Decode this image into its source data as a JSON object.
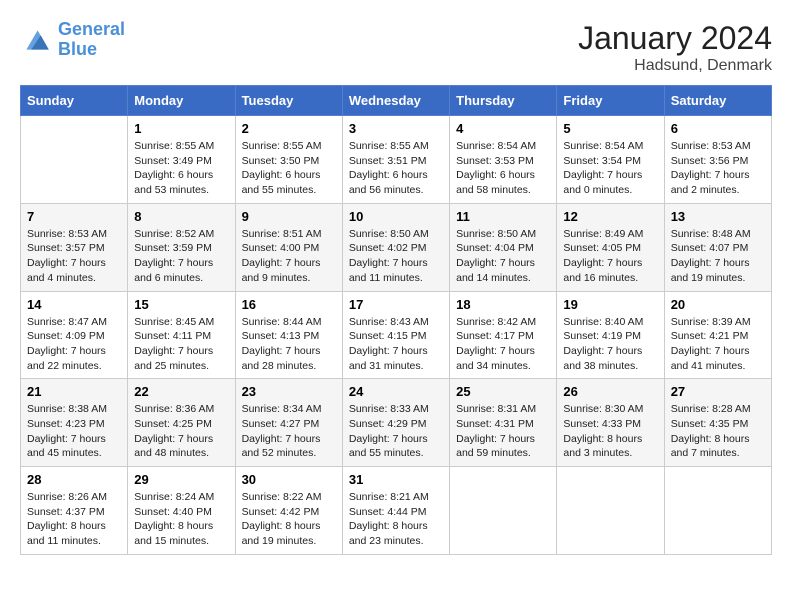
{
  "logo": {
    "line1": "General",
    "line2": "Blue"
  },
  "title": "January 2024",
  "location": "Hadsund, Denmark",
  "days_header": [
    "Sunday",
    "Monday",
    "Tuesday",
    "Wednesday",
    "Thursday",
    "Friday",
    "Saturday"
  ],
  "weeks": [
    [
      {
        "day": "",
        "sunrise": "",
        "sunset": "",
        "daylight": ""
      },
      {
        "day": "1",
        "sunrise": "Sunrise: 8:55 AM",
        "sunset": "Sunset: 3:49 PM",
        "daylight": "Daylight: 6 hours and 53 minutes."
      },
      {
        "day": "2",
        "sunrise": "Sunrise: 8:55 AM",
        "sunset": "Sunset: 3:50 PM",
        "daylight": "Daylight: 6 hours and 55 minutes."
      },
      {
        "day": "3",
        "sunrise": "Sunrise: 8:55 AM",
        "sunset": "Sunset: 3:51 PM",
        "daylight": "Daylight: 6 hours and 56 minutes."
      },
      {
        "day": "4",
        "sunrise": "Sunrise: 8:54 AM",
        "sunset": "Sunset: 3:53 PM",
        "daylight": "Daylight: 6 hours and 58 minutes."
      },
      {
        "day": "5",
        "sunrise": "Sunrise: 8:54 AM",
        "sunset": "Sunset: 3:54 PM",
        "daylight": "Daylight: 7 hours and 0 minutes."
      },
      {
        "day": "6",
        "sunrise": "Sunrise: 8:53 AM",
        "sunset": "Sunset: 3:56 PM",
        "daylight": "Daylight: 7 hours and 2 minutes."
      }
    ],
    [
      {
        "day": "7",
        "sunrise": "Sunrise: 8:53 AM",
        "sunset": "Sunset: 3:57 PM",
        "daylight": "Daylight: 7 hours and 4 minutes."
      },
      {
        "day": "8",
        "sunrise": "Sunrise: 8:52 AM",
        "sunset": "Sunset: 3:59 PM",
        "daylight": "Daylight: 7 hours and 6 minutes."
      },
      {
        "day": "9",
        "sunrise": "Sunrise: 8:51 AM",
        "sunset": "Sunset: 4:00 PM",
        "daylight": "Daylight: 7 hours and 9 minutes."
      },
      {
        "day": "10",
        "sunrise": "Sunrise: 8:50 AM",
        "sunset": "Sunset: 4:02 PM",
        "daylight": "Daylight: 7 hours and 11 minutes."
      },
      {
        "day": "11",
        "sunrise": "Sunrise: 8:50 AM",
        "sunset": "Sunset: 4:04 PM",
        "daylight": "Daylight: 7 hours and 14 minutes."
      },
      {
        "day": "12",
        "sunrise": "Sunrise: 8:49 AM",
        "sunset": "Sunset: 4:05 PM",
        "daylight": "Daylight: 7 hours and 16 minutes."
      },
      {
        "day": "13",
        "sunrise": "Sunrise: 8:48 AM",
        "sunset": "Sunset: 4:07 PM",
        "daylight": "Daylight: 7 hours and 19 minutes."
      }
    ],
    [
      {
        "day": "14",
        "sunrise": "Sunrise: 8:47 AM",
        "sunset": "Sunset: 4:09 PM",
        "daylight": "Daylight: 7 hours and 22 minutes."
      },
      {
        "day": "15",
        "sunrise": "Sunrise: 8:45 AM",
        "sunset": "Sunset: 4:11 PM",
        "daylight": "Daylight: 7 hours and 25 minutes."
      },
      {
        "day": "16",
        "sunrise": "Sunrise: 8:44 AM",
        "sunset": "Sunset: 4:13 PM",
        "daylight": "Daylight: 7 hours and 28 minutes."
      },
      {
        "day": "17",
        "sunrise": "Sunrise: 8:43 AM",
        "sunset": "Sunset: 4:15 PM",
        "daylight": "Daylight: 7 hours and 31 minutes."
      },
      {
        "day": "18",
        "sunrise": "Sunrise: 8:42 AM",
        "sunset": "Sunset: 4:17 PM",
        "daylight": "Daylight: 7 hours and 34 minutes."
      },
      {
        "day": "19",
        "sunrise": "Sunrise: 8:40 AM",
        "sunset": "Sunset: 4:19 PM",
        "daylight": "Daylight: 7 hours and 38 minutes."
      },
      {
        "day": "20",
        "sunrise": "Sunrise: 8:39 AM",
        "sunset": "Sunset: 4:21 PM",
        "daylight": "Daylight: 7 hours and 41 minutes."
      }
    ],
    [
      {
        "day": "21",
        "sunrise": "Sunrise: 8:38 AM",
        "sunset": "Sunset: 4:23 PM",
        "daylight": "Daylight: 7 hours and 45 minutes."
      },
      {
        "day": "22",
        "sunrise": "Sunrise: 8:36 AM",
        "sunset": "Sunset: 4:25 PM",
        "daylight": "Daylight: 7 hours and 48 minutes."
      },
      {
        "day": "23",
        "sunrise": "Sunrise: 8:34 AM",
        "sunset": "Sunset: 4:27 PM",
        "daylight": "Daylight: 7 hours and 52 minutes."
      },
      {
        "day": "24",
        "sunrise": "Sunrise: 8:33 AM",
        "sunset": "Sunset: 4:29 PM",
        "daylight": "Daylight: 7 hours and 55 minutes."
      },
      {
        "day": "25",
        "sunrise": "Sunrise: 8:31 AM",
        "sunset": "Sunset: 4:31 PM",
        "daylight": "Daylight: 7 hours and 59 minutes."
      },
      {
        "day": "26",
        "sunrise": "Sunrise: 8:30 AM",
        "sunset": "Sunset: 4:33 PM",
        "daylight": "Daylight: 8 hours and 3 minutes."
      },
      {
        "day": "27",
        "sunrise": "Sunrise: 8:28 AM",
        "sunset": "Sunset: 4:35 PM",
        "daylight": "Daylight: 8 hours and 7 minutes."
      }
    ],
    [
      {
        "day": "28",
        "sunrise": "Sunrise: 8:26 AM",
        "sunset": "Sunset: 4:37 PM",
        "daylight": "Daylight: 8 hours and 11 minutes."
      },
      {
        "day": "29",
        "sunrise": "Sunrise: 8:24 AM",
        "sunset": "Sunset: 4:40 PM",
        "daylight": "Daylight: 8 hours and 15 minutes."
      },
      {
        "day": "30",
        "sunrise": "Sunrise: 8:22 AM",
        "sunset": "Sunset: 4:42 PM",
        "daylight": "Daylight: 8 hours and 19 minutes."
      },
      {
        "day": "31",
        "sunrise": "Sunrise: 8:21 AM",
        "sunset": "Sunset: 4:44 PM",
        "daylight": "Daylight: 8 hours and 23 minutes."
      },
      {
        "day": "",
        "sunrise": "",
        "sunset": "",
        "daylight": ""
      },
      {
        "day": "",
        "sunrise": "",
        "sunset": "",
        "daylight": ""
      },
      {
        "day": "",
        "sunrise": "",
        "sunset": "",
        "daylight": ""
      }
    ]
  ]
}
